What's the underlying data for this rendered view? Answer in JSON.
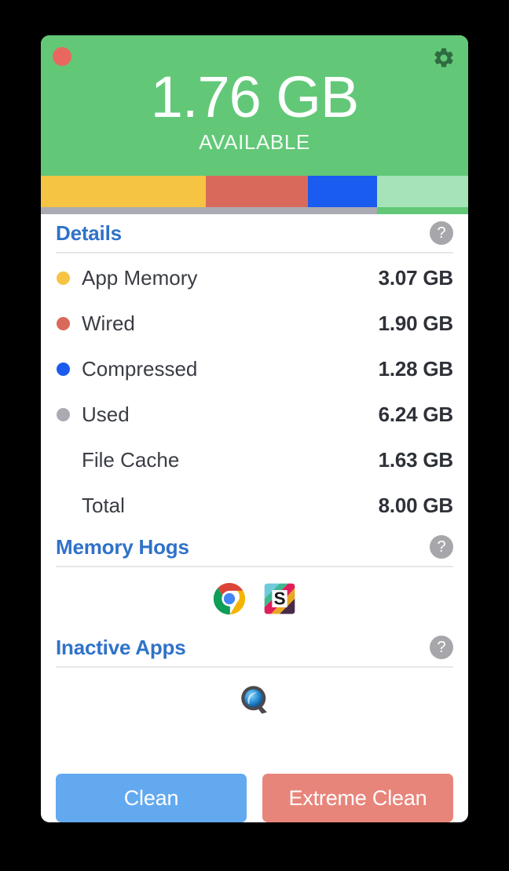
{
  "window": {
    "title_bar": {
      "close_label": "close",
      "settings_label": "settings"
    }
  },
  "header": {
    "amount": "1.76 GB",
    "caption": "AVAILABLE",
    "background_color": "#62c878",
    "close_button_color": "#e8685f",
    "gear_icon_color": "#2f6b41",
    "gear_icon": "gear-icon",
    "close_icon": "close-icon"
  },
  "memory_bar": {
    "segments": [
      {
        "name": "App Memory",
        "color": "#f5c443",
        "percent": 38.6
      },
      {
        "name": "Wired",
        "color": "#d96a5b",
        "percent": 23.9
      },
      {
        "name": "Compressed",
        "color": "#1a5bf0",
        "percent": 16.2
      },
      {
        "name": "Available",
        "color": "#a7e3b8",
        "percent": 21.3
      }
    ],
    "used_underline": {
      "color": "#aaabb2",
      "percent": 78.7
    }
  },
  "details": {
    "title": "Details",
    "help_label": "?",
    "rows": [
      {
        "label": "App Memory",
        "value": "3.07 GB",
        "dot_color": "#f5c443"
      },
      {
        "label": "Wired",
        "value": "1.90 GB",
        "dot_color": "#d96a5b"
      },
      {
        "label": "Compressed",
        "value": "1.28 GB",
        "dot_color": "#1a5bf0"
      },
      {
        "label": "Used",
        "value": "6.24 GB",
        "dot_color": "#aaabb2"
      },
      {
        "label": "File Cache",
        "value": "1.63 GB",
        "dot_color": ""
      },
      {
        "label": "Total",
        "value": "8.00 GB",
        "dot_color": ""
      }
    ]
  },
  "memory_hogs": {
    "title": "Memory Hogs",
    "help_label": "?",
    "apps": [
      {
        "name": "Google Chrome",
        "icon": "chrome-icon"
      },
      {
        "name": "Slack",
        "icon": "slack-icon"
      }
    ]
  },
  "inactive_apps": {
    "title": "Inactive Apps",
    "help_label": "?",
    "apps": [
      {
        "name": "QuickTime Player",
        "icon": "quicktime-icon"
      }
    ]
  },
  "actions": {
    "clean_label": "Clean",
    "clean_color": "#63a9ef",
    "extreme_label": "Extreme Clean",
    "extreme_color": "#e8857b"
  }
}
